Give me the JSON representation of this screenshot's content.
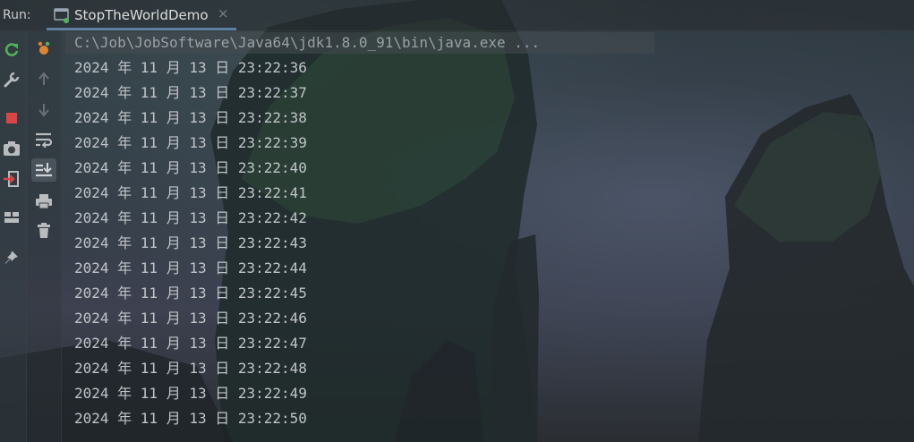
{
  "run_panel": {
    "label": "Run:",
    "tab": {
      "title": "StopTheWorldDemo",
      "close": "×"
    }
  },
  "left_toolbar": {
    "items": [
      {
        "icon": "rerun-icon",
        "color": "#4fb35a"
      },
      {
        "icon": "wrench-icon",
        "color": "#b9bcbf"
      },
      {
        "icon": "stop-icon",
        "color": "#d84545"
      },
      {
        "icon": "camera-icon",
        "color": "#b9bcbf"
      },
      {
        "icon": "exit-icon",
        "color": "#d84545"
      },
      {
        "icon": "layout-icon",
        "color": "#b9bcbf"
      },
      {
        "icon": "pin-icon",
        "color": "#b9bcbf"
      }
    ]
  },
  "second_toolbar": {
    "items": [
      {
        "icon": "debug-icon",
        "color": "#e0852f"
      },
      {
        "icon": "up-arrow-icon",
        "color": "#6b7075"
      },
      {
        "icon": "down-arrow-icon",
        "color": "#6b7075"
      },
      {
        "icon": "soft-wrap-icon",
        "color": "#b9bcbf"
      },
      {
        "icon": "scroll-to-end-icon",
        "color": "#b9bcbf"
      },
      {
        "icon": "print-icon",
        "color": "#b9bcbf"
      },
      {
        "icon": "trash-icon",
        "color": "#b9bcbf"
      }
    ]
  },
  "console": {
    "command": "C:\\Job\\JobSoftware\\Java64\\jdk1.8.0_91\\bin\\java.exe ...",
    "lines": [
      "2024 年 11 月 13 日 23:22:36",
      "2024 年 11 月 13 日 23:22:37",
      "2024 年 11 月 13 日 23:22:38",
      "2024 年 11 月 13 日 23:22:39",
      "2024 年 11 月 13 日 23:22:40",
      "2024 年 11 月 13 日 23:22:41",
      "2024 年 11 月 13 日 23:22:42",
      "2024 年 11 月 13 日 23:22:43",
      "2024 年 11 月 13 日 23:22:44",
      "2024 年 11 月 13 日 23:22:45",
      "2024 年 11 月 13 日 23:22:46",
      "2024 年 11 月 13 日 23:22:47",
      "2024 年 11 月 13 日 23:22:48",
      "2024 年 11 月 13 日 23:22:49",
      "2024 年 11 月 13 日 23:22:50"
    ]
  }
}
